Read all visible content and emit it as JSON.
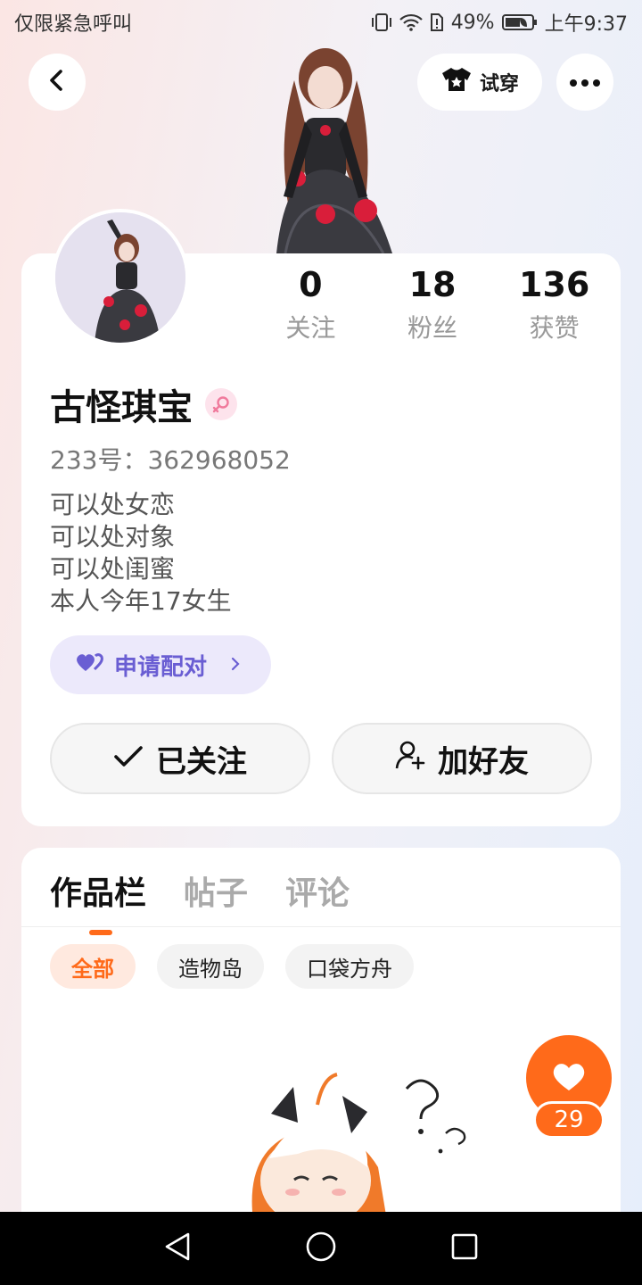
{
  "status": {
    "left_text": "仅限紧急呼叫",
    "battery": "49%",
    "time": "上午9:37"
  },
  "header": {
    "tryon_label": "试穿"
  },
  "stats": [
    {
      "value": "0",
      "label": "关注"
    },
    {
      "value": "18",
      "label": "粉丝"
    },
    {
      "value": "136",
      "label": "获赞"
    }
  ],
  "profile": {
    "name": "古怪琪宝",
    "uid": "233号：362968052",
    "bio": [
      "可以处女恋",
      "可以处对象",
      "可以处闺蜜",
      "本人今年17女生"
    ],
    "pair_label": "申请配对",
    "follow_label": "已关注",
    "friend_label": "加好友"
  },
  "tabs": [
    "作品栏",
    "帖子",
    "评论"
  ],
  "chips": [
    "全部",
    "造物岛",
    "口袋方舟"
  ],
  "like_count": "29",
  "icons": {
    "back": "back-arrow-icon",
    "tryon": "tshirt-icon",
    "more": "more-dots-icon",
    "gender": "female-icon",
    "pair": "hearts-icon",
    "follow": "check-icon",
    "friend": "add-friend-icon",
    "like": "heart-icon"
  },
  "colors": {
    "accent": "#ff6a1a",
    "pair_bg": "#ece9fb",
    "pair_text": "#6a5ed3"
  }
}
